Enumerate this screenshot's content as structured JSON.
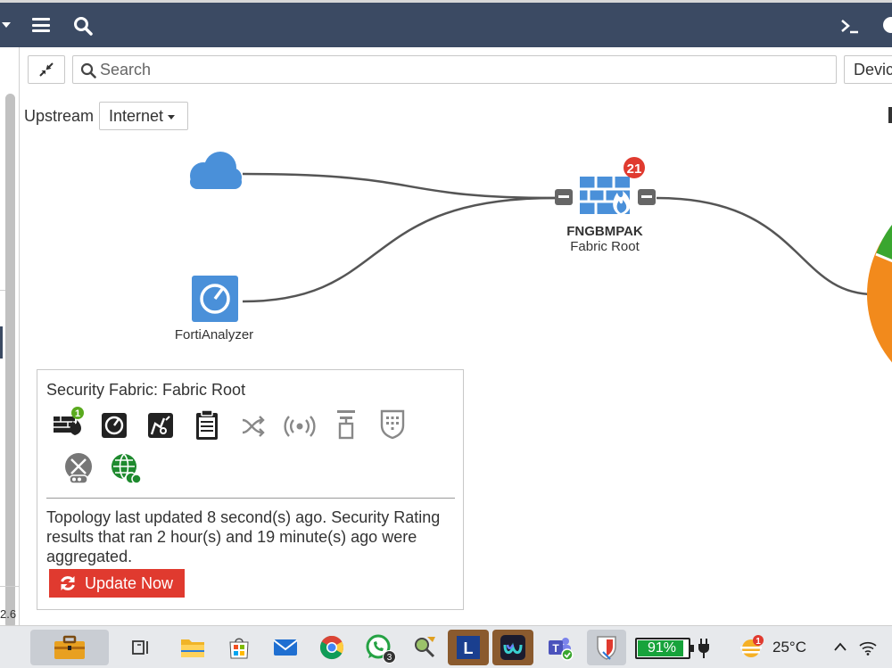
{
  "toolbar": {
    "search_placeholder": "Search",
    "device_button_label": "Devic"
  },
  "upstream": {
    "label": "Upstream",
    "selected": "Internet"
  },
  "topology": {
    "fortigate": {
      "name": "FNGBMPAK",
      "role": "Fabric Root",
      "alert_count": "21"
    },
    "analyzer_label": "FortiAnalyzer"
  },
  "sidebar": {
    "version_fragment": "2.6"
  },
  "panel": {
    "title": "Security Fabric: Fabric Root",
    "firewall_badge": "1",
    "info_text": "Topology last updated 8 second(s) ago. Security Rating results that ran 2 hour(s) and 19 minute(s) ago were aggregated.",
    "update_button": "Update Now",
    "icons": [
      "fortigate-firewall-icon",
      "fortianalyzer-icon",
      "fortisandbox-icon",
      "fortimanager-icon",
      "fortiswitch-icon",
      "fortiap-icon",
      "fortiextender-icon",
      "fortiweb-icon",
      "fortimail-icon",
      "forticloud-icon"
    ]
  },
  "taskbar": {
    "whatsapp_badge": "3",
    "battery_percent": "91%",
    "battery_level": 0.91,
    "weather_badge": "1",
    "temperature": "25°C"
  },
  "colors": {
    "header_bg": "#3b4a63",
    "fortinet_blue": "#4a90d9",
    "alert_red": "#e03a2f",
    "success_green": "#5aaa1e",
    "chart_orange": "#f28a1c",
    "chart_green": "#3aa62f"
  }
}
